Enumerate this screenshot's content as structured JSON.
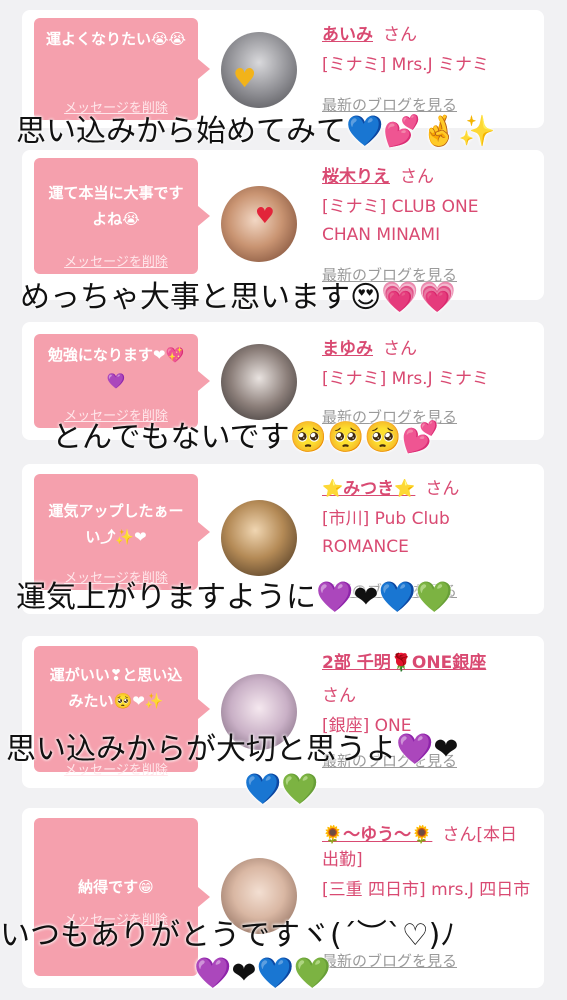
{
  "cards": [
    {
      "message": "運よくなりたい😭😭",
      "delete_label": "メッセージを削除",
      "name": "あいみ",
      "honorific": "さん",
      "shop": "[ミナミ] Mrs.J ミナミ",
      "blog_label": "最新のブログを見る",
      "overlay": "思い込みから始めてみて💙💕🤞✨"
    },
    {
      "message": "運て本当に大事ですよね😭",
      "delete_label": "メッセージを削除",
      "name": "桜木りえ",
      "honorific": "さん",
      "shop": "[ミナミ] CLUB ONE CHAN MINAMI",
      "blog_label": "最新のブログを見る",
      "overlay": "めっちゃ大事と思います😍💗💗"
    },
    {
      "message": "勉強になります❤💖💜",
      "delete_label": "メッセージを削除",
      "name": "まゆみ",
      "honorific": "さん",
      "shop": "[ミナミ] Mrs.J ミナミ",
      "blog_label": "最新のブログを見る",
      "overlay": "とんでもないです🥺🥺🥺💕"
    },
    {
      "message": "運気アップしたぁーい⤴✨❤",
      "delete_label": "メッセージを削除",
      "name": "⭐みつき⭐",
      "honorific": "さん",
      "shop": "[市川] Pub Club ROMANCE",
      "blog_label": "最新のブログを見る",
      "overlay": "運気上がりますように💜❤💙💚"
    },
    {
      "message": "運がいい❣と思い込みたい🥺❤✨",
      "delete_label": "メッセージを削除",
      "name": "2部 千明🌹ONE銀座",
      "honorific": "さん",
      "shop": "[銀座] ONE",
      "blog_label": "最新のブログを見る",
      "overlay": "思い込みからが大切と思うよ💜❤",
      "overlay2": "💙💚"
    },
    {
      "message": "納得です😁",
      "delete_label": "メッセージを削除",
      "name": "🌻〜ゆう〜🌻",
      "honorific": "さん[本日出勤]",
      "shop": "[三重 四日市] mrs.J 四日市",
      "blog_label": "最新のブログを見る",
      "overlay": "いつもありがとうですヾ(´︶`♡)ﾉ",
      "overlay2": "💜❤💙💚"
    }
  ],
  "colors": {
    "accent": "#d94a72",
    "bubble": "#f5a0ad",
    "card": "#ffffff",
    "background": "#f1f1f3"
  }
}
